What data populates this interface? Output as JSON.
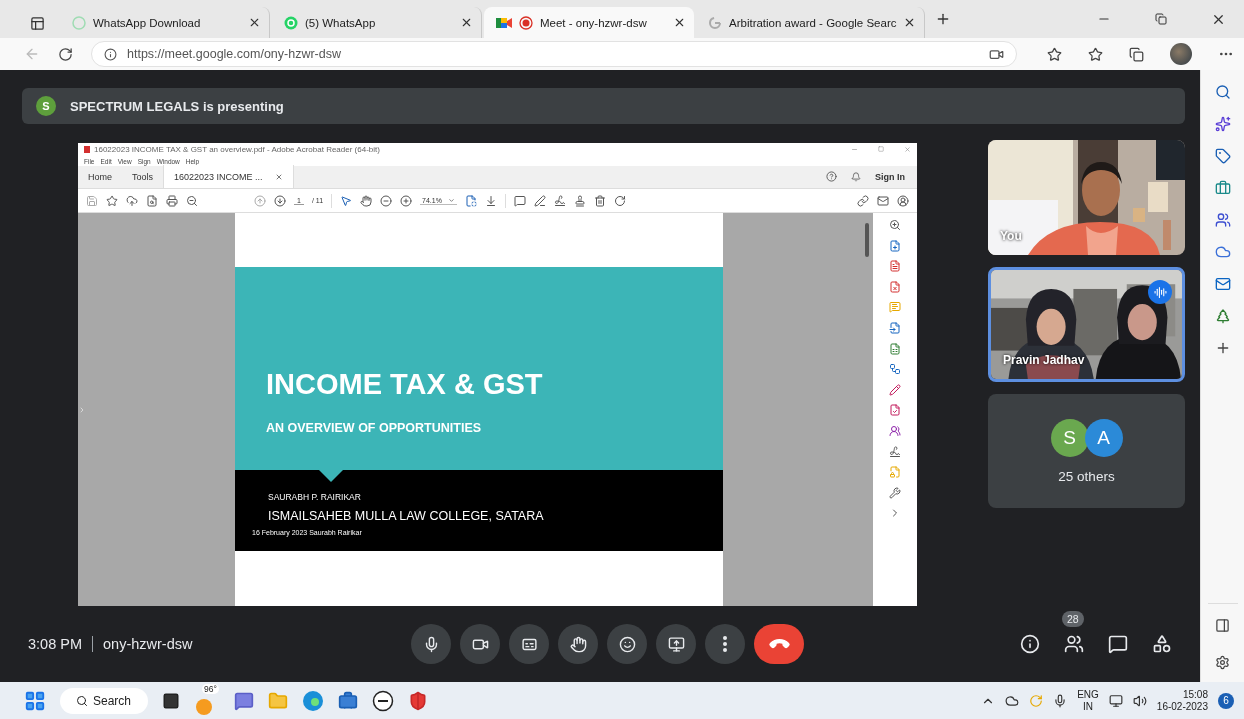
{
  "browser": {
    "tabs": [
      {
        "title": "WhatsApp Download",
        "kind": "whatsapp",
        "selected": false,
        "recording": false
      },
      {
        "title": "(5) WhatsApp",
        "kind": "whatsapp-unread",
        "selected": false,
        "recording": false
      },
      {
        "title": "Meet - ony-hzwr-dsw",
        "kind": "meet",
        "selected": true,
        "recording": true
      },
      {
        "title": "Arbitration award - Google Searc",
        "kind": "google",
        "selected": false,
        "recording": false
      }
    ],
    "url": "https://meet.google.com/ony-hzwr-dsw"
  },
  "banner": {
    "avatar": "S",
    "text": "SPECTRUM LEGALS is presenting"
  },
  "acrobat": {
    "title": "16022023 INCOME TAX & GST an overview.pdf - Adobe Acrobat Reader (64-bit)",
    "menu": [
      "File",
      "Edit",
      "View",
      "Sign",
      "Window",
      "Help"
    ],
    "tabs": [
      {
        "label": "Home",
        "selected": false
      },
      {
        "label": "Tools",
        "selected": false
      },
      {
        "label": "16022023 INCOME ...",
        "selected": true
      }
    ],
    "sign_in": "Sign In",
    "page": "1",
    "page_count": "/ 11",
    "zoom": "74.1%",
    "slide": {
      "title": "INCOME TAX & GST",
      "subtitle": "AN OVERVIEW OF OPPORTUNITIES",
      "author": "SAURABH P. RAIRIKAR",
      "college": "ISMAILSAHEB MULLA LAW COLLEGE, SATARA",
      "footer": "16 February 2023 Saurabh Rairikar"
    }
  },
  "tiles": [
    {
      "name": "You",
      "speaking": false
    },
    {
      "name": "Pravin Jadhav",
      "speaking": true
    }
  ],
  "others": {
    "avatars": [
      {
        "letter": "S",
        "color": "#6aa84f"
      },
      {
        "letter": "A",
        "color": "#2b8ad8"
      }
    ],
    "label": "25 others"
  },
  "bottom_bar": {
    "time": "3:08 PM",
    "meeting_code": "ony-hzwr-dsw",
    "people_count": "28"
  },
  "taskbar": {
    "search": "Search",
    "weather": "96°",
    "language": "ENG",
    "region": "IN",
    "time": "15:08",
    "date": "16-02-2023",
    "notifications": "6"
  }
}
